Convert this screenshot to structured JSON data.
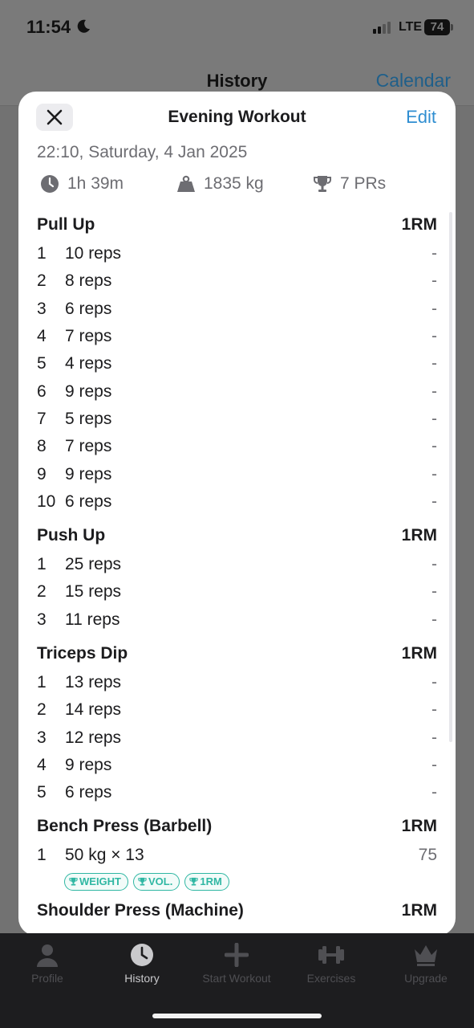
{
  "status_bar": {
    "time": "11:54",
    "network": "LTE",
    "battery": "74"
  },
  "background": {
    "title": "History",
    "calendar_label": "Calendar"
  },
  "sheet": {
    "title": "Evening Workout",
    "edit_label": "Edit",
    "datetime": "22:10, Saturday, 4 Jan 2025",
    "stats": {
      "duration": "1h 39m",
      "volume": "1835 kg",
      "prs": "7 PRs"
    }
  },
  "exercises": [
    {
      "name": "Pull Up",
      "metric": "1RM",
      "sets": [
        {
          "num": "1",
          "reps": "10 reps",
          "value": "-"
        },
        {
          "num": "2",
          "reps": "8 reps",
          "value": "-"
        },
        {
          "num": "3",
          "reps": "6 reps",
          "value": "-"
        },
        {
          "num": "4",
          "reps": "7 reps",
          "value": "-"
        },
        {
          "num": "5",
          "reps": "4 reps",
          "value": "-"
        },
        {
          "num": "6",
          "reps": "9 reps",
          "value": "-"
        },
        {
          "num": "7",
          "reps": "5 reps",
          "value": "-"
        },
        {
          "num": "8",
          "reps": "7 reps",
          "value": "-"
        },
        {
          "num": "9",
          "reps": "9 reps",
          "value": "-"
        },
        {
          "num": "10",
          "reps": "6 reps",
          "value": "-"
        }
      ]
    },
    {
      "name": "Push Up",
      "metric": "1RM",
      "sets": [
        {
          "num": "1",
          "reps": "25 reps",
          "value": "-"
        },
        {
          "num": "2",
          "reps": "15 reps",
          "value": "-"
        },
        {
          "num": "3",
          "reps": "11 reps",
          "value": "-"
        }
      ]
    },
    {
      "name": "Triceps Dip",
      "metric": "1RM",
      "sets": [
        {
          "num": "1",
          "reps": "13 reps",
          "value": "-"
        },
        {
          "num": "2",
          "reps": "14 reps",
          "value": "-"
        },
        {
          "num": "3",
          "reps": "12 reps",
          "value": "-"
        },
        {
          "num": "4",
          "reps": "9 reps",
          "value": "-"
        },
        {
          "num": "5",
          "reps": "6 reps",
          "value": "-"
        }
      ]
    },
    {
      "name": "Bench Press (Barbell)",
      "metric": "1RM",
      "sets": [
        {
          "num": "1",
          "reps": "50 kg × 13",
          "value": "75",
          "badges": [
            "WEIGHT",
            "VOL.",
            "1RM"
          ]
        }
      ]
    },
    {
      "name": "Shoulder Press (Machine)",
      "metric": "1RM",
      "sets": []
    }
  ],
  "tab_bar": {
    "tabs": [
      {
        "label": "Profile",
        "icon": "person-icon"
      },
      {
        "label": "History",
        "icon": "clock-icon"
      },
      {
        "label": "Start Workout",
        "icon": "plus-icon"
      },
      {
        "label": "Exercises",
        "icon": "dumbbell-icon"
      },
      {
        "label": "Upgrade",
        "icon": "crown-icon"
      }
    ],
    "active": "History"
  },
  "colors": {
    "accent": "#2f8ed1",
    "pr_badge": "#2fb7a3",
    "tab_bar": "#1d1d1f"
  }
}
